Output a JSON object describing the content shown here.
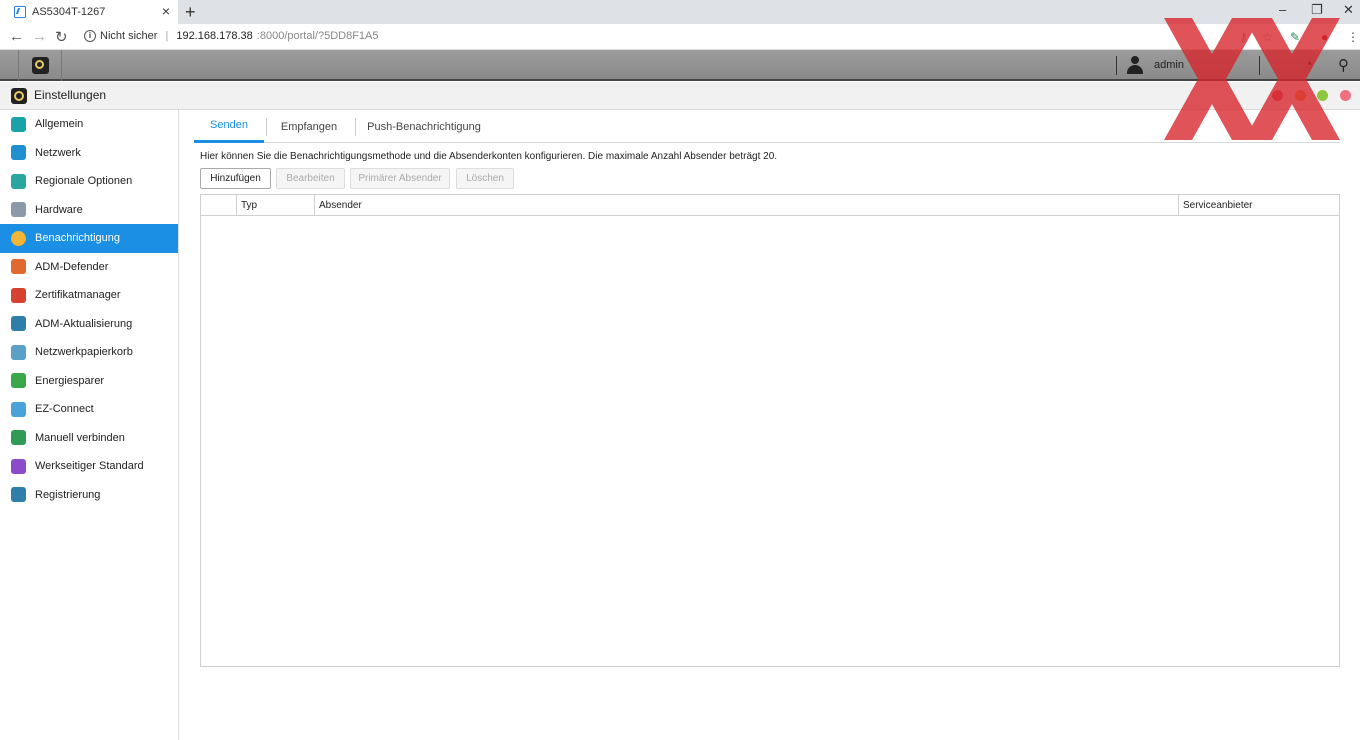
{
  "browser": {
    "tab_title": "AS5304T-1267",
    "close_glyph": "×",
    "newtab_glyph": "+",
    "security_label": "Nicht sicher",
    "url_host": "192.168.178.38",
    "url_path": ":8000/portal/?5DD8F1A5",
    "window_controls": [
      "–",
      "❐",
      "✕"
    ]
  },
  "topbar": {
    "username": "admin"
  },
  "app": {
    "title": "Einstellungen",
    "window_dots": [
      "#e0606a",
      "#f3a25a",
      "#8dc63f",
      "#f07080"
    ]
  },
  "sidebar": {
    "items": [
      {
        "label": "Allgemein",
        "icon": "general-icon",
        "color": "#19a3a8"
      },
      {
        "label": "Netzwerk",
        "icon": "globe-icon",
        "color": "#1f8fcf"
      },
      {
        "label": "Regionale Optionen",
        "icon": "region-icon",
        "color": "#2aa6a0"
      },
      {
        "label": "Hardware",
        "icon": "hardware-icon",
        "color": "#8b9aa6"
      },
      {
        "label": "Benachrichtigung",
        "icon": "notification-icon",
        "color": "#f2b535"
      },
      {
        "label": "ADM-Defender",
        "icon": "firewall-icon",
        "color": "#e0692e"
      },
      {
        "label": "Zertifikatmanager",
        "icon": "certificate-icon",
        "color": "#d7412f"
      },
      {
        "label": "ADM-Aktualisierung",
        "icon": "update-icon",
        "color": "#2d7ea8"
      },
      {
        "label": "Netzwerkpapierkorb",
        "icon": "recycle-bin-icon",
        "color": "#5aa0c8"
      },
      {
        "label": "Energiesparer",
        "icon": "energy-icon",
        "color": "#3aa64a"
      },
      {
        "label": "EZ-Connect",
        "icon": "cloud-icon",
        "color": "#4aa3d8"
      },
      {
        "label": "Manuell verbinden",
        "icon": "connect-icon",
        "color": "#2f9b57"
      },
      {
        "label": "Werkseitiger Standard",
        "icon": "reset-icon",
        "color": "#8c4bc8"
      },
      {
        "label": "Registrierung",
        "icon": "registration-icon",
        "color": "#2d7ea8"
      }
    ],
    "active_index": 4
  },
  "tabs": [
    "Senden",
    "Empfangen",
    "Push-Benachrichtigung"
  ],
  "main": {
    "description": "Hier können Sie die Benachrichtigungsmethode und die Absenderkonten konfigurieren. Die maximale Anzahl Absender beträgt 20.",
    "buttons": {
      "add": "Hinzufügen",
      "edit": "Bearbeiten",
      "primary": "Primärer Absender",
      "delete": "Löschen"
    },
    "columns": [
      "Typ",
      "Absender",
      "Serviceanbieter"
    ],
    "rows": []
  },
  "accent_color": "#1a8fe3"
}
